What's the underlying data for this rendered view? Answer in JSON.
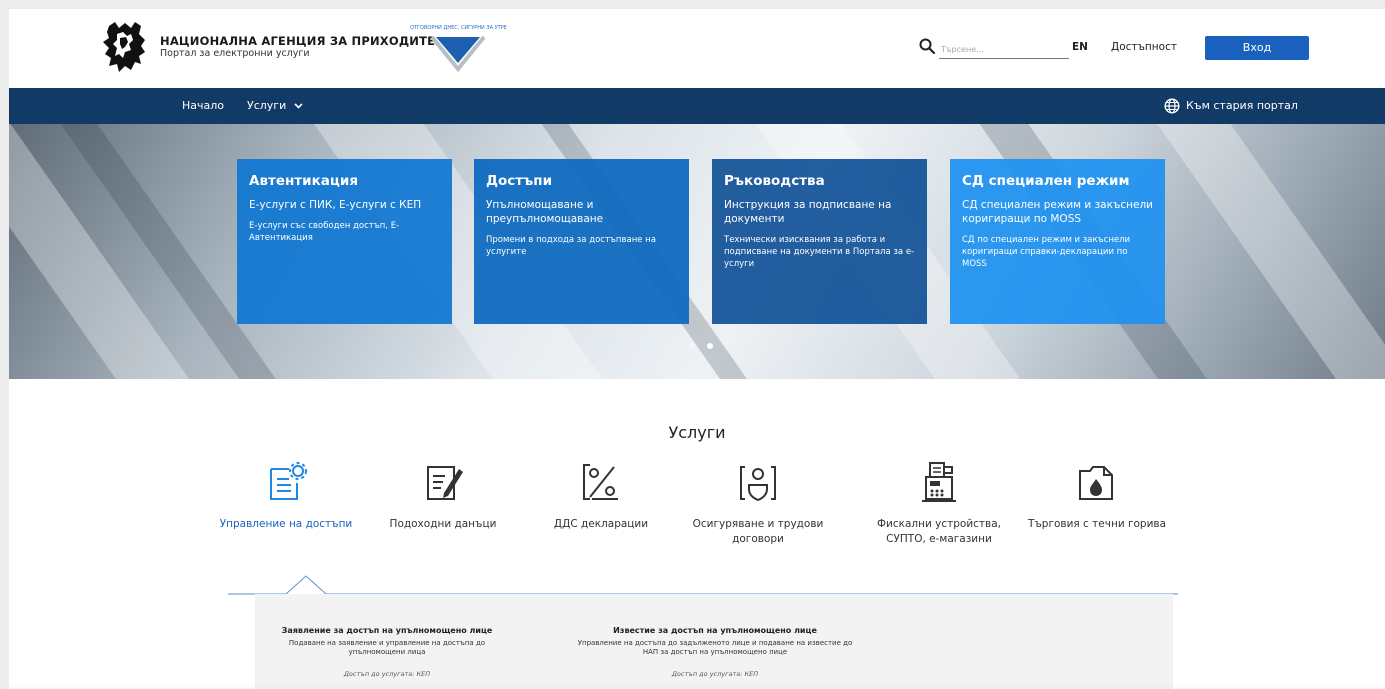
{
  "header": {
    "agency_name": "НАЦИОНАЛНА АГЕНЦИЯ ЗА ПРИХОДИТЕ",
    "agency_subtitle": "Портал за електронни услуги",
    "emblem_text": "ОТГОВОРНИ ДНЕС. СИГУРНИ ЗА УТРЕ",
    "search_placeholder": "Търсене...",
    "lang_label": "EN",
    "accessibility_label": "Достъпност",
    "login_label": "Вход"
  },
  "nav": {
    "home": "Начало",
    "services": "Услуги",
    "old_portal": "Към стария портал"
  },
  "hero": {
    "cards": [
      {
        "title": "Автентикация",
        "line1": "Е-услуги с ПИК, Е-услуги с КЕП",
        "line2": "Е-услуги със свободен достъп, Е-Автентикация"
      },
      {
        "title": "Достъпи",
        "line1": "Упълномощаване и преупълномощаване",
        "line2": "Промени в подхода за достъпване на услугите"
      },
      {
        "title": "Ръководства",
        "line1": "Инструкция за подписване на документи",
        "line2": "Технически изисквания за работа и подписване на документи в Портала за е-услуги"
      },
      {
        "title": "СД специален режим",
        "line1": "СД специален режим и закъснели коригиращи по MOSS",
        "line2": "СД по специален режим и закъснели коригиращи справки-декларации по MOSS"
      }
    ],
    "active_slide": 2
  },
  "services": {
    "title": "Услуги",
    "items": [
      {
        "label": "Управление на достъпи",
        "icon": "document-gear-icon",
        "active": true
      },
      {
        "label": "Подоходни данъци",
        "icon": "document-pen-icon",
        "active": false
      },
      {
        "label": "ДДС декларации",
        "icon": "percent-document-icon",
        "active": false
      },
      {
        "label": "Осигуряване и трудови договори",
        "icon": "person-shield-icon",
        "active": false
      },
      {
        "label": "Фискални устройства, СУПТО, е-магазини",
        "icon": "cash-register-icon",
        "active": false
      },
      {
        "label": "Търговия с течни горива",
        "icon": "fuel-folder-icon",
        "active": false
      }
    ]
  },
  "details": [
    {
      "title": "Заявление за достъп на упълномощено лице",
      "desc": "Подаване на заявление и управление на достъпа до упълномощени лица",
      "access": "Достъп до услугата: КЕП"
    },
    {
      "title": "Известие за достъп на упълномощено лице",
      "desc": "Управление на достъпа до задълженото лице и подаване на известие до НАП за достъп на упълномощено лице",
      "access": "Достъп до услугата: КЕП"
    }
  ],
  "colors": {
    "navbar": "#123a66",
    "primary": "#1961bd",
    "active_text": "#1961bd"
  }
}
